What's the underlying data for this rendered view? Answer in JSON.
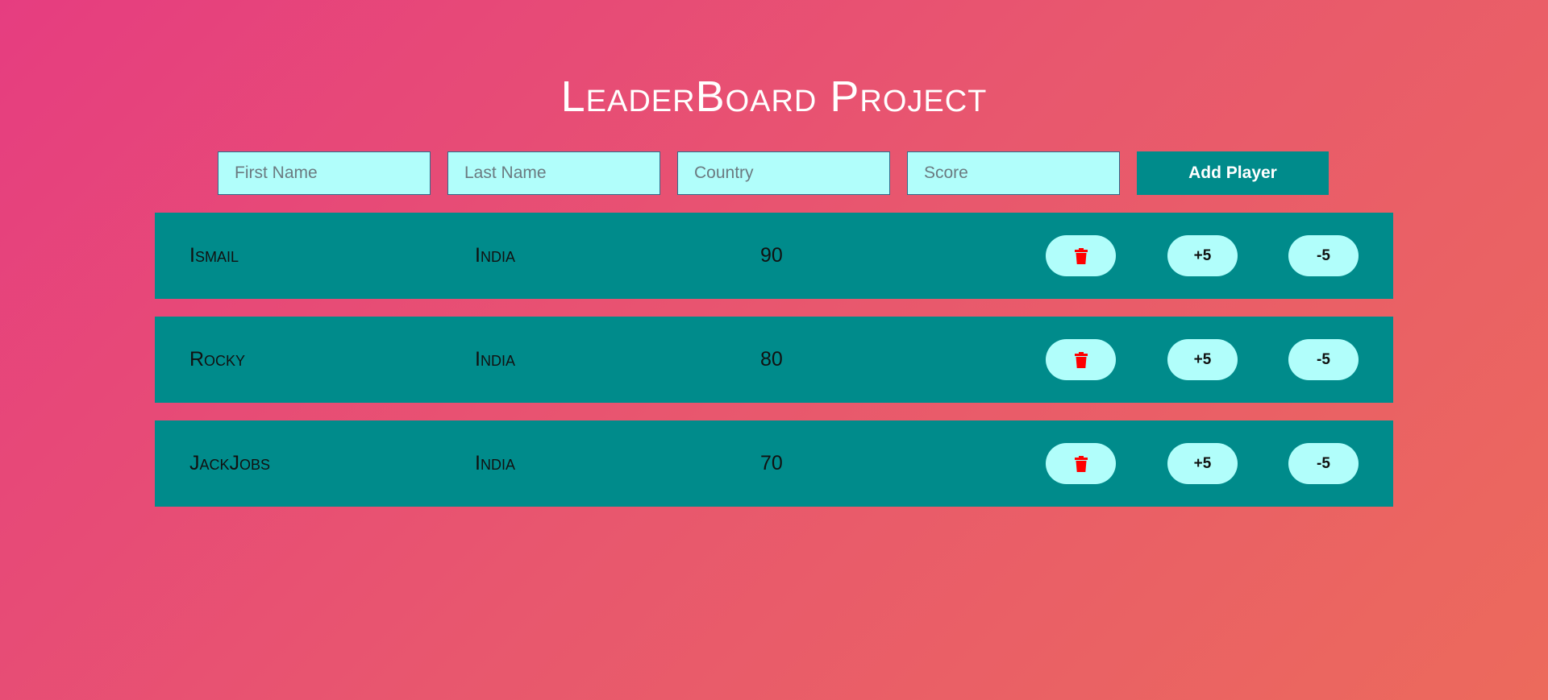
{
  "title": "LeaderBoard Project",
  "form": {
    "first_name_placeholder": "First Name",
    "last_name_placeholder": "Last Name",
    "country_placeholder": "Country",
    "score_placeholder": "Score",
    "add_label": "Add Player"
  },
  "players": [
    {
      "name": "Ismail",
      "country": "India",
      "score": "90",
      "plus": "+5",
      "minus": "-5",
      "delete_icon": "trash-icon"
    },
    {
      "name": "Rocky",
      "country": "India",
      "score": "80",
      "plus": "+5",
      "minus": "-5",
      "delete_icon": "trash-icon"
    },
    {
      "name": "JackJobs",
      "country": "India",
      "score": "70",
      "plus": "+5",
      "minus": "-5",
      "delete_icon": "trash-icon"
    }
  ],
  "colors": {
    "background_start": "#e63d80",
    "background_end": "#ec6a5c",
    "row": "#008b8b",
    "input": "#b1fefb",
    "trash": "#ff0000"
  }
}
